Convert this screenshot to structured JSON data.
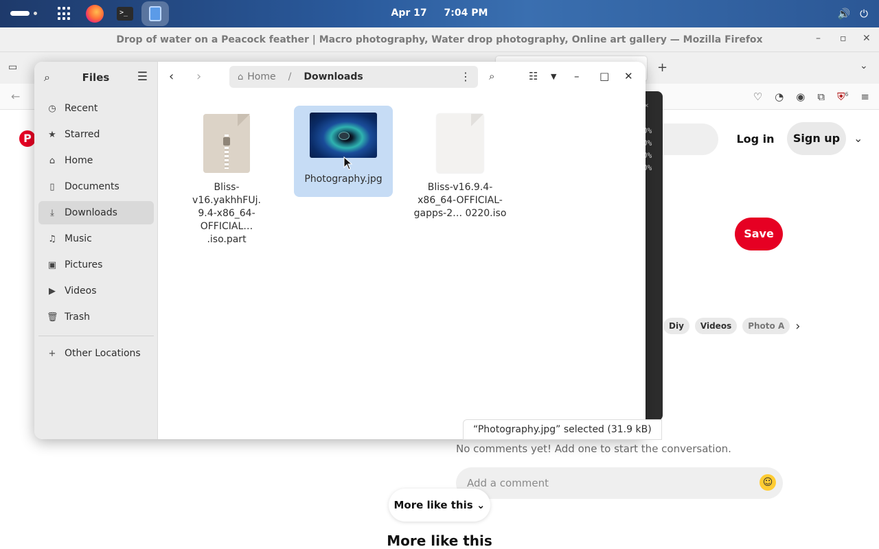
{
  "topbar": {
    "date": "Apr 17",
    "time": "7:04 PM",
    "icons": [
      "activities-pill",
      "app-grid-icon",
      "firefox-icon",
      "terminal-icon",
      "files-icon",
      "volume-icon",
      "power-icon"
    ]
  },
  "firefox": {
    "window_title": "Drop of water on a Peacock feather | Macro photography, Water drop photography, Online art gallery — Mozilla Firefox",
    "toolbar_badge": "6"
  },
  "pinterest": {
    "login": "Log in",
    "signup": "Sign up",
    "save": "Save",
    "chips": [
      "Diy",
      "Videos",
      "Photo A"
    ],
    "no_comments": "No comments yet! Add one to start the conversation.",
    "comment_placeholder": "Add a comment",
    "more_button": "More like this",
    "more_title": "More like this"
  },
  "terminal": {
    "lines": [
      "0%",
      "0%",
      "0%",
      "0%"
    ]
  },
  "files": {
    "title": "Files",
    "sidebar": [
      {
        "label": "Recent",
        "icon": "clock-icon"
      },
      {
        "label": "Starred",
        "icon": "star-icon"
      },
      {
        "label": "Home",
        "icon": "home-icon"
      },
      {
        "label": "Documents",
        "icon": "document-icon"
      },
      {
        "label": "Downloads",
        "icon": "download-icon",
        "active": true
      },
      {
        "label": "Music",
        "icon": "music-icon"
      },
      {
        "label": "Pictures",
        "icon": "picture-icon"
      },
      {
        "label": "Videos",
        "icon": "video-icon"
      },
      {
        "label": "Trash",
        "icon": "trash-icon"
      }
    ],
    "other_locations": "Other Locations",
    "path": {
      "home": "Home",
      "separator": "/",
      "current": "Downloads"
    },
    "items": [
      {
        "line1": "Bliss-v16.yakhhFUj.",
        "line2": "9.4-x86_64-",
        "line3": "OFFICIAL… .iso.part",
        "type": "archive"
      },
      {
        "line1": "Photography.jpg",
        "type": "image",
        "selected": true
      },
      {
        "line1": "Bliss-v16.9.4-",
        "line2": "x86_64-OFFICIAL-",
        "line3": "gapps-2…  0220.iso",
        "type": "blank"
      }
    ],
    "status": "“Photography.jpg” selected  (31.9 kB)"
  },
  "colors": {
    "accent": "#e60023",
    "selection": "#c6dcf5",
    "sidebar": "#ebebeb"
  }
}
